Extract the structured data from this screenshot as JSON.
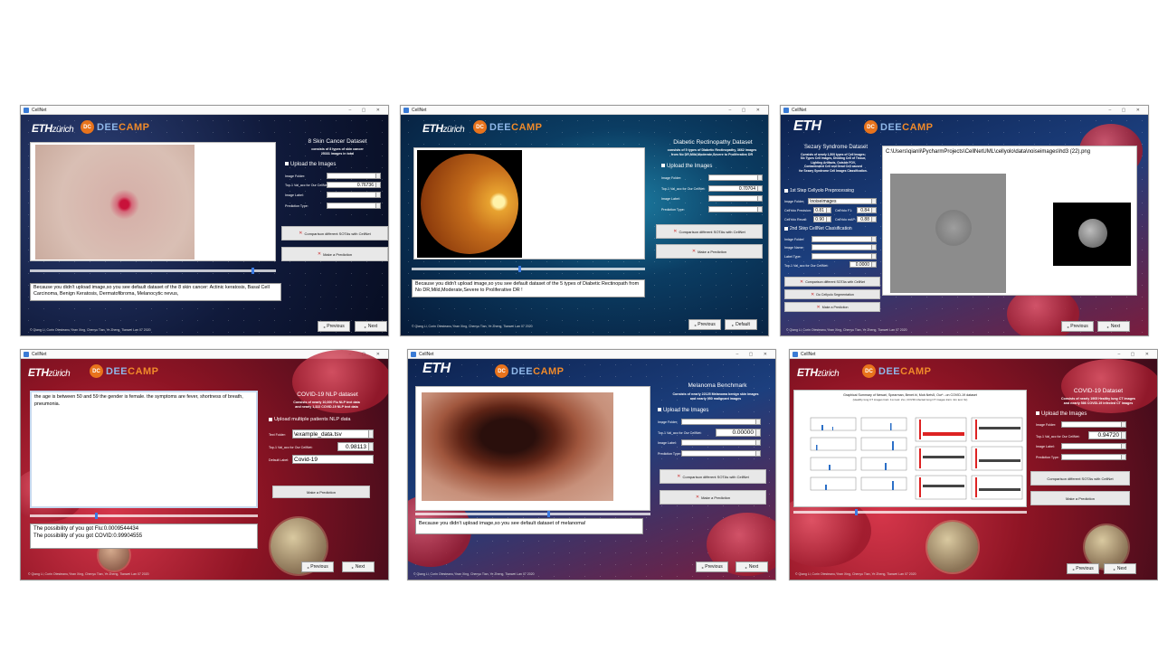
{
  "w1": {
    "title": "CellNet",
    "dataset_title": "8 Skin Cancer Dataset",
    "desc": [
      "consists of 8 types of skin cancer",
      "25331 images in total"
    ],
    "upload": "Upload the Images",
    "labels": [
      "Image Folder:",
      "Top-1 Val_acc for Our CellNet:",
      "Image Label:",
      "Prediction Type:"
    ],
    "acc_value": "0.76736",
    "btn_compare": "Comparison different SOTAs with CellNet",
    "btn_predict": "Make a Prediction",
    "message": "Because you didn't upload image,so you see default dataset of the 8 skin cancer: Actinic keratosis, Basal Cell Carcinoma, Benign Keratosis, Dermatofibroma, Melanocytic nevus,",
    "credits": "© Qiang Li, Corin Otesteanu,Yiran Xing, Chenyu Tian, Ye Zheng, Tianwei Lan 07 2020",
    "prev": "Previous",
    "next": "Next"
  },
  "w2": {
    "title": "CellNet",
    "dataset_title": "Diabetic Rectinopathy Dataset",
    "desc": [
      "consists of 5 types of Diabetic Rectinopathy, 3662 images",
      "from No DR,Mild,Moderate,Severe to Proliferative DR"
    ],
    "upload": "Upload the Images",
    "labels": [
      "Image Folder:",
      "Top-1 Val_acc for Our CellNet:",
      "Image Label:",
      "Prediction Type:"
    ],
    "acc_value": "0.70704",
    "btn_compare": "Comparison different SOTAs with CellNet",
    "btn_predict": "Make a Prediction",
    "message": "Because you didn't upload image,so you see default dataset of the 5 types of Diabetic Rectinopath from No DR,Mild,Moderate,Severe to Proliferative DR  !",
    "credits": "© Qiang Li, Corin Otesteanu,Yiran Xing, Chenyu Tian, Ye Zheng, Tianwei Lan 07 2020",
    "prev": "Previous",
    "next": "Default"
  },
  "w3": {
    "title": "CellNet",
    "dataset_title": "Sezary Syndrome Dataset",
    "desc": [
      "Consists of nearly 1,500 types of Cell Images:",
      "Six Types Cell Images, Dividing Cell of Tissue,",
      "Lighting Artifacts, Outside FOV,",
      "Contaminated Cell and Dead Cell caused",
      "for Sezary Syndrome Cell Images Classification."
    ],
    "path": "C:\\Users\\qianli\\PycharmProjects\\CellNetUML\\cellyolo\\data\\noiseimages\\hd3 (22).png",
    "step1": "1st Step Cellyolo Preprocessing",
    "folder_label": "Image Folder:",
    "folder_value": "\\noiseimages",
    "metrics": [
      {
        "label": "CellYolo Precision:",
        "value": "0.81"
      },
      {
        "label": "CellYolo F1:",
        "value": "0.84"
      },
      {
        "label": "CellYolo Recall:",
        "value": "0.90"
      },
      {
        "label": "CellYolo mAP:",
        "value": "0.88"
      }
    ],
    "step2": "2nd Step CellNet Classification",
    "labels2": [
      "Image Folder:",
      "Image Name:",
      "Label Type:",
      "Top-1 Val_acc for Our CellNet:"
    ],
    "acc_value": "0.0000",
    "btn_compare": "Comparison different SOTAs with CellNet",
    "btn_seg": "Do Cellyolo Segmentation",
    "btn_predict": "Make a Prediction",
    "credits": "© Qiang Li, Corin Otesteanu,Yiran Xing, Chenyu Tian, Ye Zheng, Tianwei Lan 07 2020",
    "prev": "Previous",
    "next": "Next"
  },
  "w4": {
    "title": "CellNet",
    "dataset_title": "COVID-19 NLP dataset",
    "desc": [
      "Consists of nearly 10,000 Flu NLP text data",
      "and nearly 1,322 COVID-19 NLP text data"
    ],
    "text": "the age is between 50 and 59 the gender is female. the symptoms are fever, shortness of breath, pneumonia.",
    "upload": "Upload multiple patients NLP data",
    "labels": [
      "Text Folder:",
      "Top-1 Val_acc for Our CellNet:",
      "Default Label:"
    ],
    "file_value": "\\example_data.tsv",
    "acc_value": "0.98113",
    "label_value": "Covid-19",
    "btn_predict": "Make a Prediction",
    "result1": "The possibility of you got Flu:0.0009544434",
    "result2": "The possibility of you got COVID:0.99904555",
    "credits": "© Qiang Li, Corin Otesteanu,Yiran Xing, Chenyu Tian, Ye Zheng, Tianwei Lan 07 2020",
    "prev": "Previous",
    "next": "Next"
  },
  "w5": {
    "title": "CellNet",
    "dataset_title": "Melanoma Benchmark",
    "desc": [
      "Consists of nearly 22125 Melanoma benign skin  images",
      "and nearly 950 malignant  images"
    ],
    "upload": "Upload the Images",
    "labels": [
      "Image Folder:",
      "Top-1 Val_acc for Our CellNet:",
      "Image Label:",
      "Prediction Type:"
    ],
    "acc_value": "0.00000",
    "btn_compare": "Comparison different SOTAs with CellNet",
    "btn_predict": "Make a Prediction",
    "message": "Because you didn't upload image,so you see default dataset of melanoma!",
    "credits": "© Qiang Li, Corin Otesteanu,Yiran Xing, Chenyu Tian, Ye Zheng, Tianwei Lan 07 2020",
    "prev": "Previous",
    "next": "Next"
  },
  "w6": {
    "title": "CellNet",
    "dataset_title": "COVID-19  Dataset",
    "desc": [
      "Consists of nearly 1905 Healthy  lung CT  images",
      "and nearly 586 COVID-19 infected CT images"
    ],
    "upload": "Upload the Images",
    "labels": [
      "Image Folder:",
      "Top-1 Val_acc for Our CellNet:",
      "Image Label:",
      "Prediction Type:"
    ],
    "acc_value": "0.94720",
    "btn_compare": "Comparison different SOTAs with CellNet",
    "btn_predict": "Make a Prediction",
    "chart_title": "Graphical Summary of Newari, Spearman, Benet.hi, Mob.Netv5, Our*...on COVID-19 dataset",
    "chart_sub": "(Healthy lung CT images train: 1xx test: 2xx, COVID infected lung CT images train: 4xx test: 9x)",
    "credits": "© Qiang Li, Corin Otesteanu,Yiran Xing, Chenyu Tian, Ye Zheng, Tianwei Lan 07 2020",
    "prev": "Previous",
    "next": "Next"
  }
}
